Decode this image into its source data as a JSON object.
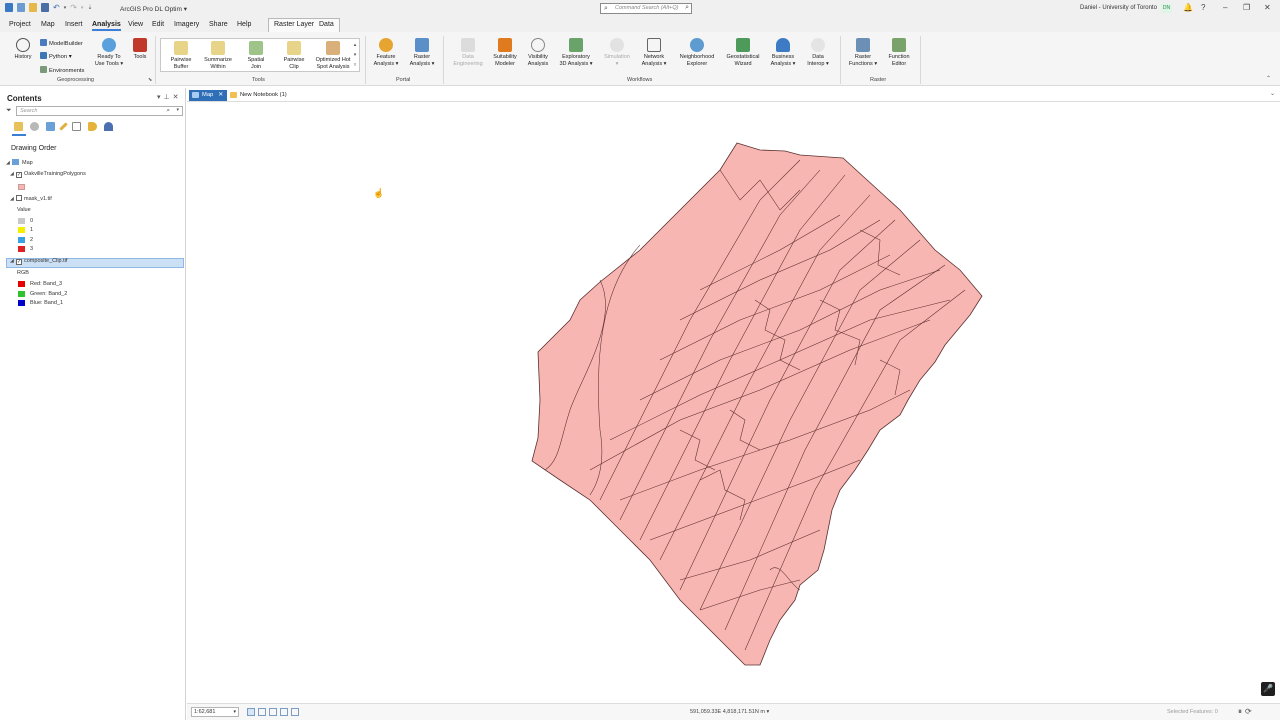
{
  "app": {
    "title": "ArcGIS Pro DL Optim",
    "command_search_placeholder": "Command Search (Alt+Q)",
    "user_name": "Daniel - University of Toronto",
    "user_initials": "DN"
  },
  "ribbon_tabs": {
    "project": "Project",
    "map": "Map",
    "insert": "Insert",
    "analysis": "Analysis",
    "view": "View",
    "edit": "Edit",
    "imagery": "Imagery",
    "share": "Share",
    "help": "Help",
    "raster_layer": "Raster Layer",
    "data": "Data"
  },
  "ribbon": {
    "history": "History",
    "modelbuilder": "ModelBuilder",
    "python": "Python",
    "environments": "Environments",
    "ready_to_use_1": "Ready To",
    "ready_to_use_2": "Use Tools",
    "tools_btn": "Tools",
    "pairwise_buffer_1": "Pairwise",
    "pairwise_buffer_2": "Buffer",
    "summarize_within_1": "Summarize",
    "summarize_within_2": "Within",
    "spatial_join_1": "Spatial",
    "spatial_join_2": "Join",
    "pairwise_clip_1": "Pairwise",
    "pairwise_clip_2": "Clip",
    "hot_spot_1": "Optimized Hot",
    "hot_spot_2": "Spot Analysis",
    "feature_analysis_1": "Feature",
    "feature_analysis_2": "Analysis",
    "raster_analysis_1": "Raster",
    "raster_analysis_2": "Analysis",
    "data_engineering_1": "Data",
    "data_engineering_2": "Engineering",
    "suitability_1": "Suitability",
    "suitability_2": "Modeler",
    "visibility_1": "Visibility",
    "visibility_2": "Analysis",
    "exploratory_1": "Exploratory",
    "exploratory_2": "3D Analysis",
    "simulation": "Simulation",
    "network_1": "Network",
    "network_2": "Analysis",
    "neighborhood_1": "Neighborhood",
    "neighborhood_2": "Explorer",
    "geostat_1": "Geostatistical",
    "geostat_2": "Wizard",
    "business_1": "Business",
    "business_2": "Analysis",
    "data_interop_1": "Data",
    "data_interop_2": "Interop",
    "raster_functions_1": "Raster",
    "raster_functions_2": "Functions",
    "function_editor_1": "Function",
    "function_editor_2": "Editor",
    "group_geoprocessing": "Geoprocessing",
    "group_tools": "Tools",
    "group_portal": "Portal",
    "group_workflows": "Workflows",
    "group_raster": "Raster"
  },
  "contents": {
    "title": "Contents",
    "search_placeholder": "Search",
    "drawing_order": "Drawing Order",
    "map_label": "Map",
    "layer1": "OakvilleTrainingPolygons",
    "layer2": "mask_v1.tif",
    "value_label": "Value",
    "values": [
      "0",
      "1",
      "2",
      "3"
    ],
    "layer3": "composite_Clip.tif",
    "rgb_label": "RGB",
    "red_band": "Red:   Band_3",
    "green_band": "Green: Band_2",
    "blue_band": "Blue:  Band_1",
    "colors": {
      "polygon_fill": "#f7b6b2",
      "value_0": "#c8c8c8",
      "value_1": "#f5f000",
      "value_2": "#3aa0e6",
      "value_3": "#e02020",
      "red": "#e60000",
      "green": "#2fc22f",
      "blue": "#0000c8"
    }
  },
  "view_tabs": {
    "map": "Map",
    "notebook": "New Notebook (1)"
  },
  "status": {
    "scale": "1:62,681",
    "coordinates": "591,059.33E 4,818,171.51N m",
    "selected_features": "Selected Features: 0"
  }
}
